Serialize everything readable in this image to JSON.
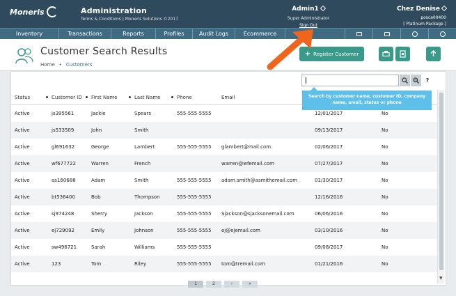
{
  "header": {
    "logo_text": "Moneris",
    "app_title": "Administration",
    "app_sub": "Terms & Conditions | Moneris Solutions ©2017",
    "user_name": "Admin1",
    "user_role": "Super Administrator",
    "sign_out": "Sign Out",
    "merchant_name": "Chez  Denise",
    "merchant_id": "posca00400",
    "merchant_package": "[ Platinum Package ]"
  },
  "nav": {
    "items": [
      "Inventory",
      "Transactions",
      "Reports",
      "Profiles",
      "Audit Logs",
      "Ecommerce"
    ],
    "icons": [
      "printer-icon",
      "mail-icon",
      "help-icon",
      "settings-icon"
    ]
  },
  "page": {
    "title": "Customer Search Results",
    "breadcrumb_home": "Home",
    "breadcrumb_sep": "•",
    "breadcrumb_current": "Customers",
    "register_label": "Register Customer",
    "tool_icons": [
      "print-icon",
      "export-icon",
      "upload-icon"
    ]
  },
  "search": {
    "value": "",
    "tooltip": "Search by customer name, customer ID, company name, email, status or phone",
    "help": "?"
  },
  "table": {
    "headers": [
      "Status",
      "Customer ID",
      "First Name",
      "Last Name",
      "Phone",
      "Email",
      "",
      ""
    ],
    "rows": [
      [
        "Active",
        "js395561",
        "Jackie",
        "Spears",
        "555-555-5555",
        "",
        "12/01/2017",
        "No"
      ],
      [
        "Active",
        "js533509",
        "John",
        "Smith",
        "",
        "",
        "09/13/2017",
        "No"
      ],
      [
        "Active",
        "gl691632",
        "George",
        "Lambert",
        "555-555-5555",
        "glambert@mail.com",
        "02/06/2017",
        "No"
      ],
      [
        "Active",
        "wf677722",
        "Warren",
        "French",
        "",
        "warren@wfemail.com",
        "07/27/2017",
        "No"
      ],
      [
        "Active",
        "as160688",
        "Adam",
        "Smith",
        "555-555-5555",
        "adam.smith@asmithemail.com",
        "01/30/2017",
        "No"
      ],
      [
        "Active",
        "bt536400",
        "Bob",
        "Thompson",
        "555-555-5555",
        "",
        "12/16/2016",
        "No"
      ],
      [
        "Active",
        "sj974248",
        "Sherry",
        "Jackson",
        "555-555-5555",
        "Sjackson@sjacksonemail.com",
        "06/06/2016",
        "No"
      ],
      [
        "Active",
        "ej729092",
        "Emily",
        "Johnson",
        "555-555-5555",
        "ej@ejemail.com",
        "03/10/2016",
        "No"
      ],
      [
        "Active",
        "sw496721",
        "Sarah",
        "Williams",
        "555-555-5555",
        "",
        "09/08/2017",
        "No"
      ],
      [
        "Active",
        "123",
        "Tom",
        "Riley",
        "555-555-5555",
        "tom@tremail.com",
        "01/21/2016",
        "No"
      ]
    ]
  },
  "pager": {
    "pages": [
      "1",
      "2",
      "›",
      "»"
    ]
  },
  "colors": {
    "header_bg": "#2f4a5d",
    "nav_bg": "#3e6b82",
    "accent": "#3a9a8a",
    "tooltip": "#5ec0e8",
    "annotation_arrow": "#f0651e"
  }
}
